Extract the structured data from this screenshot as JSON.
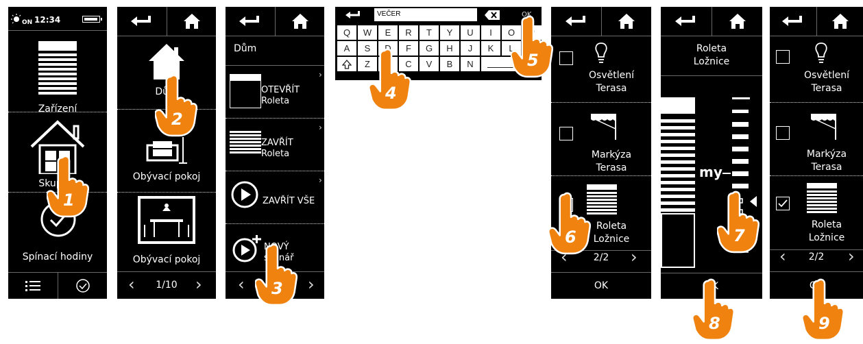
{
  "screen1": {
    "time": "12:34",
    "sun_label": "ON",
    "menu_items": [
      "Zařízení",
      "Skupiny",
      "Spínací hodiny"
    ]
  },
  "screen2": {
    "items": [
      "Dům",
      "Obývací pokoj",
      "Obývací pokoj"
    ],
    "pager": "1/10"
  },
  "screen3": {
    "title": "Dům",
    "items": [
      {
        "label": "OTEVŘÍT\nRoleta"
      },
      {
        "label": "ZAVŘÍT\nRoleta"
      },
      {
        "label": "ZAVŘÍT VŠE"
      },
      {
        "label": "NOVÝ\nscénář"
      }
    ]
  },
  "screen4": {
    "input_value": "VEČER",
    "ok_label": "OK",
    "rows": [
      [
        "Q",
        "W",
        "E",
        "R",
        "T",
        "Y",
        "U",
        "I",
        "O",
        "P"
      ],
      [
        "A",
        "S",
        "D",
        "F",
        "G",
        "H",
        "J",
        "K",
        "L"
      ],
      [
        "Z",
        "X",
        "C",
        "V",
        "B",
        "N"
      ]
    ]
  },
  "screen5": {
    "items": [
      "Osvětlení\nTerasa",
      "Markýza\nTerasa",
      "Roleta\nLožnice"
    ],
    "checked": [
      false,
      false,
      false
    ],
    "pager": "2/2",
    "ok_label": "OK"
  },
  "screen6": {
    "title": "Roleta\nLožnice",
    "my_label": "my",
    "ok_label": "OK",
    "position_fraction": 0.62
  },
  "screen7": {
    "items": [
      "Osvětlení\nTerasa",
      "Markýza\nTerasa",
      "Roleta\nLožnice"
    ],
    "checked": [
      false,
      false,
      true
    ],
    "pager": "2/2",
    "ok_label": "OK"
  },
  "steps": [
    "1",
    "2",
    "3",
    "4",
    "5",
    "6",
    "7",
    "8",
    "9"
  ],
  "colors": {
    "accent": "#f0820f",
    "screen_bg": "#000000",
    "divider": "#6a6a6a"
  }
}
